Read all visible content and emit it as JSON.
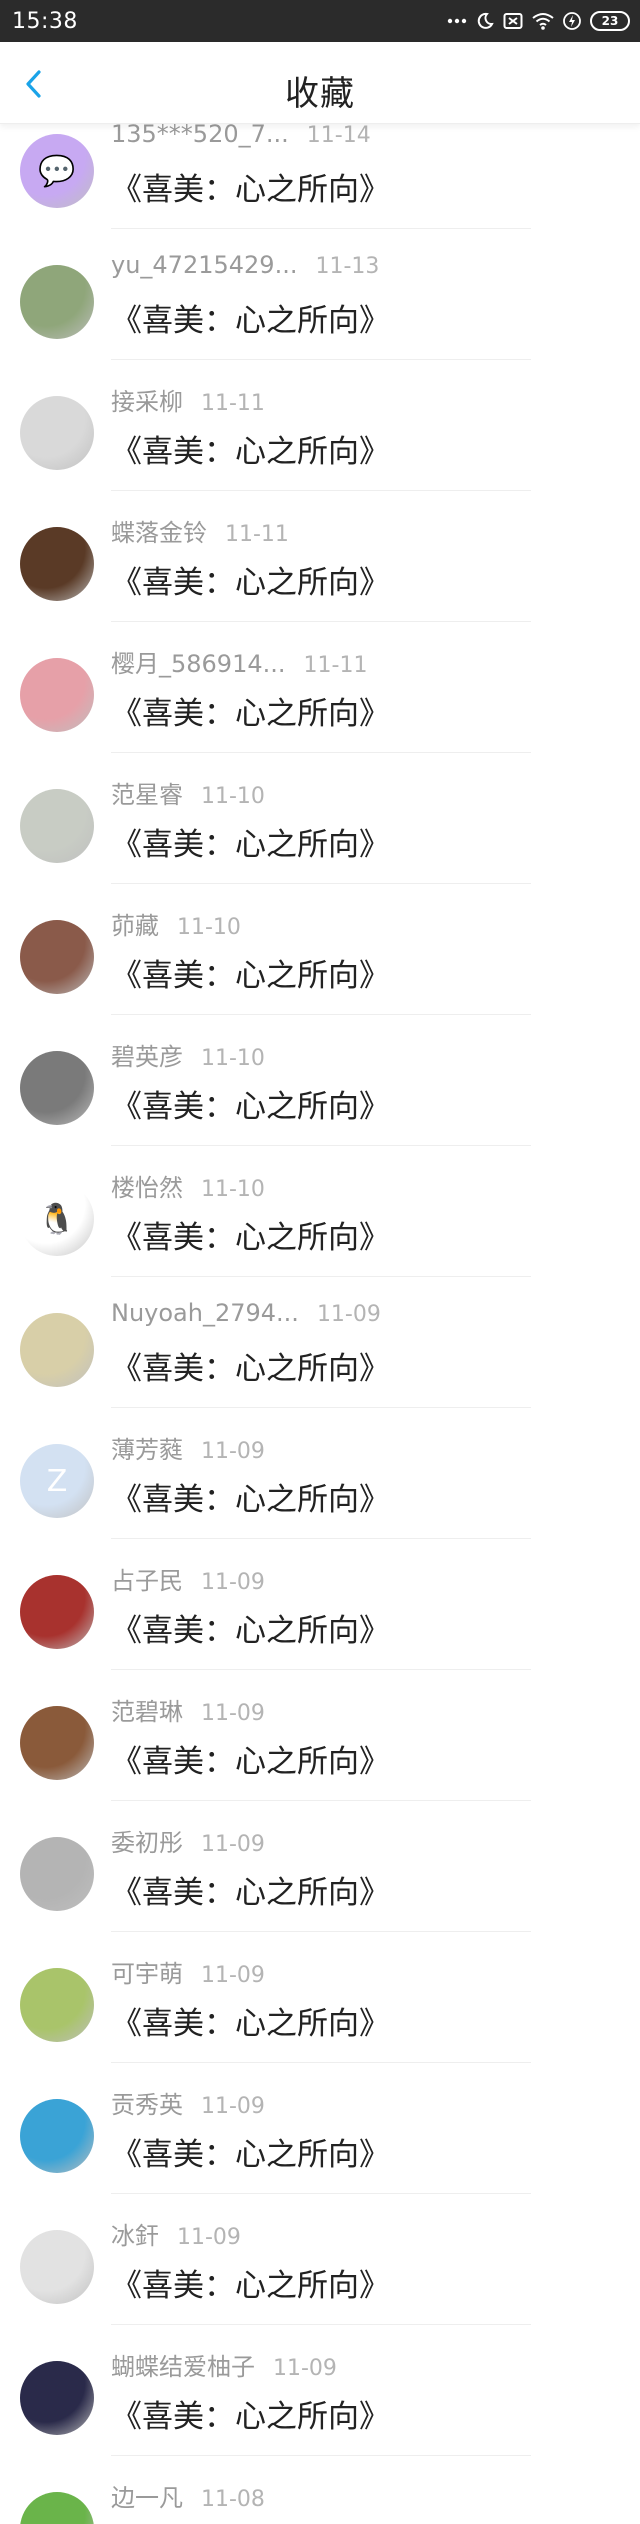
{
  "status_bar": {
    "time": "15:38",
    "battery": "23",
    "icons": [
      "dots-icon",
      "moon-icon",
      "sim-off-icon",
      "wifi-icon",
      "charging-icon",
      "battery-icon"
    ]
  },
  "header": {
    "title": "收藏",
    "back_icon": "chevron-left-icon",
    "accent_color": "#1aa3e8"
  },
  "items": [
    {
      "name": "135***520_7...",
      "date": "11-14",
      "content": "《喜美：心之所向》",
      "avatar_color": "#c7a9f2",
      "avatar_glyph": "💬"
    },
    {
      "name": "yu_47215429...",
      "date": "11-13",
      "content": "《喜美：心之所向》",
      "avatar_color": "#8fa67a",
      "avatar_glyph": ""
    },
    {
      "name": "接采柳",
      "date": "11-11",
      "content": "《喜美：心之所向》",
      "avatar_color": "#d9d9d9",
      "avatar_glyph": ""
    },
    {
      "name": "蝶落金铃",
      "date": "11-11",
      "content": "《喜美：心之所向》",
      "avatar_color": "#5a3a26",
      "avatar_glyph": ""
    },
    {
      "name": "樱月_586914...",
      "date": "11-11",
      "content": "《喜美：心之所向》",
      "avatar_color": "#e6a0a8",
      "avatar_glyph": ""
    },
    {
      "name": "范星睿",
      "date": "11-10",
      "content": "《喜美：心之所向》",
      "avatar_color": "#c8ccc4",
      "avatar_glyph": ""
    },
    {
      "name": "茆藏",
      "date": "11-10",
      "content": "《喜美：心之所向》",
      "avatar_color": "#8a5a4a",
      "avatar_glyph": ""
    },
    {
      "name": "碧英彦",
      "date": "11-10",
      "content": "《喜美：心之所向》",
      "avatar_color": "#7a7a7a",
      "avatar_glyph": ""
    },
    {
      "name": "楼怡然",
      "date": "11-10",
      "content": "《喜美：心之所向》",
      "avatar_color": "#ffffff",
      "avatar_glyph": "🐧"
    },
    {
      "name": "Nuyoah_2794...",
      "date": "11-09",
      "content": "《喜美：心之所向》",
      "avatar_color": "#d8cfa8",
      "avatar_glyph": ""
    },
    {
      "name": "薄芳蕤",
      "date": "11-09",
      "content": "《喜美：心之所向》",
      "avatar_color": "#d3e1f2",
      "avatar_glyph": "Z"
    },
    {
      "name": "占子民",
      "date": "11-09",
      "content": "《喜美：心之所向》",
      "avatar_color": "#a8322e",
      "avatar_glyph": ""
    },
    {
      "name": "范碧琳",
      "date": "11-09",
      "content": "《喜美：心之所向》",
      "avatar_color": "#8a5a3a",
      "avatar_glyph": ""
    },
    {
      "name": "委初彤",
      "date": "11-09",
      "content": "《喜美：心之所向》",
      "avatar_color": "#b4b4b4",
      "avatar_glyph": ""
    },
    {
      "name": "可宇萌",
      "date": "11-09",
      "content": "《喜美：心之所向》",
      "avatar_color": "#a9c46a",
      "avatar_glyph": ""
    },
    {
      "name": "贡秀英",
      "date": "11-09",
      "content": "《喜美：心之所向》",
      "avatar_color": "#3aa3d6",
      "avatar_glyph": ""
    },
    {
      "name": "冰釬",
      "date": "11-09",
      "content": "《喜美：心之所向》",
      "avatar_color": "#e2e2e2",
      "avatar_glyph": ""
    },
    {
      "name": "蝴蝶结爱柚子",
      "date": "11-09",
      "content": "《喜美：心之所向》",
      "avatar_color": "#2a2a4a",
      "avatar_glyph": ""
    },
    {
      "name": "边一凡",
      "date": "11-08",
      "content": "",
      "avatar_color": "#6ab44a",
      "avatar_glyph": ""
    }
  ]
}
